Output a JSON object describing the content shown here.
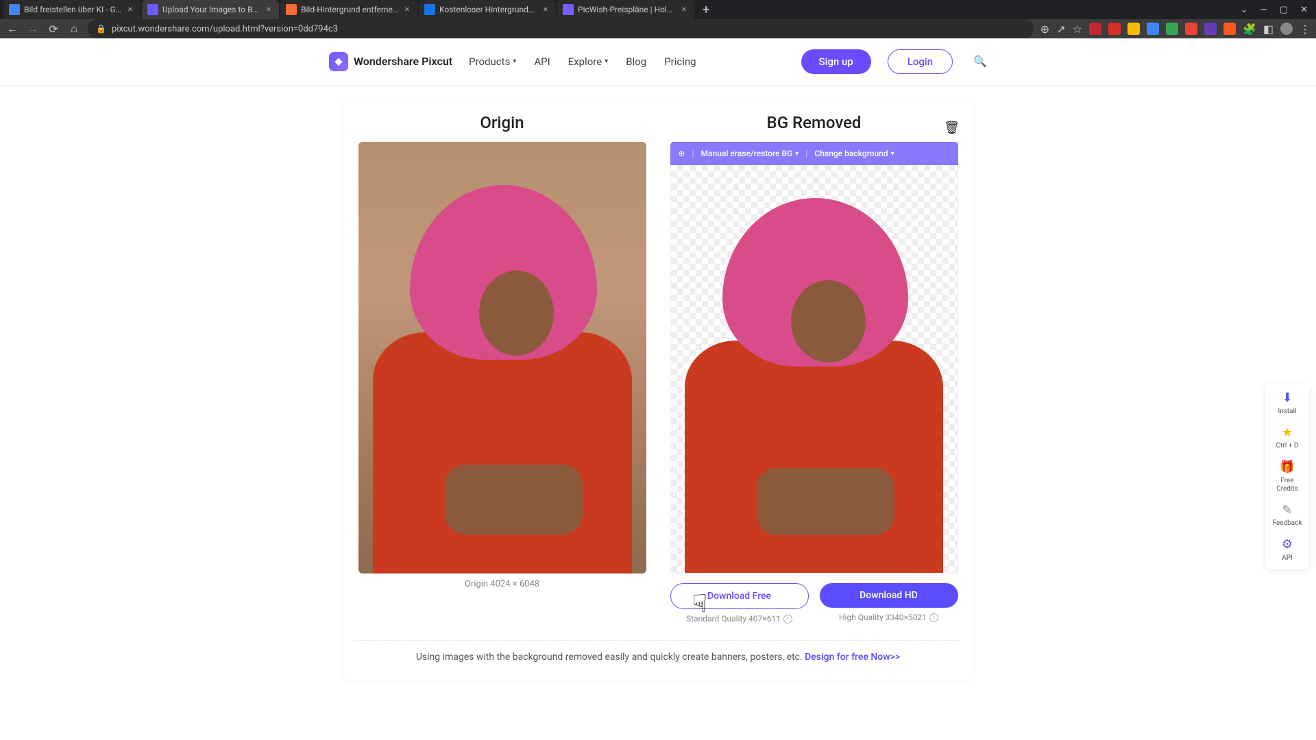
{
  "browser": {
    "tabs": [
      {
        "title": "Bild freistellen über KI - Googl"
      },
      {
        "title": "Upload Your Images to BG Rem"
      },
      {
        "title": "Bild-Hintergrund entfernen oder"
      },
      {
        "title": "Kostenloser Hintergrundentfern"
      },
      {
        "title": "PicWish-Preispläne | Holen Sie s"
      }
    ],
    "url": "pixcut.wondershare.com/upload.html?version=0dd794c3"
  },
  "header": {
    "brand": "Wondershare Pixcut",
    "nav": {
      "products": "Products",
      "api": "API",
      "explore": "Explore",
      "blog": "Blog",
      "pricing": "Pricing"
    },
    "signup": "Sign up",
    "login": "Login"
  },
  "panel": {
    "origin_title": "Origin",
    "removed_title": "BG Removed",
    "origin_caption": "Origin 4024 × 6048",
    "toolbar": {
      "erase": "Manual erase/restore BG",
      "change": "Change background"
    },
    "download_free": "Download Free",
    "download_hd": "Download HD",
    "quality_std": "Standard Quality 407×611",
    "quality_high": "High Quality 3340×5021",
    "footer_text": "Using images with the background removed easily and quickly create banners, posters, etc. ",
    "footer_link": "Design for free Now>>"
  },
  "floatbar": {
    "install": "Install",
    "bookmark": "Ctrl + D",
    "credits": "Free Credits",
    "feedback": "Feedback",
    "api": "API"
  }
}
